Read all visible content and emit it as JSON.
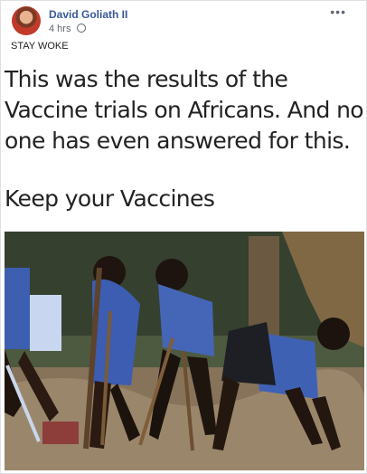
{
  "post": {
    "author": "David Goliath II",
    "time": "4 hrs",
    "more_label": "•••",
    "text": "STAY WOKE"
  },
  "meme": {
    "lines": [
      "This was the results of the",
      "Vaccine trials on Africans. And no",
      "one has even answered for this."
    ],
    "tail": "Keep your Vaccines"
  },
  "icons": {
    "avatar": "avatar-image",
    "privacy": "globe-icon",
    "options": "more-options-icon"
  }
}
